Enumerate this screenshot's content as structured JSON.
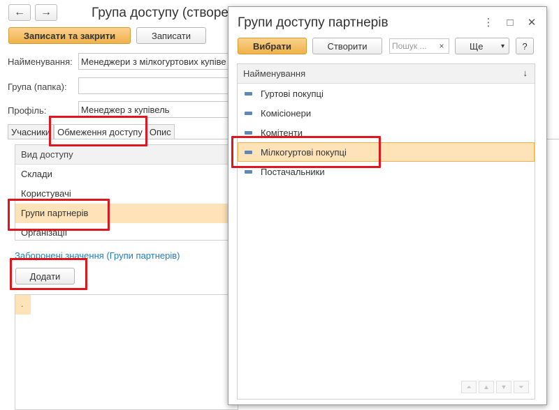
{
  "form": {
    "title": "Група доступу (створе",
    "back_glyph": "←",
    "forward_glyph": "→",
    "save_close_label": "Записати та закрити",
    "save_label": "Записати",
    "fields": {
      "name_label": "Найменування:",
      "name_value": "Менеджери з мілкогуртових купіве",
      "group_label": "Група (папка):",
      "group_value": "",
      "profile_label": "Профіль:",
      "profile_value": "Менеджер з купівель"
    },
    "tabs": [
      "Учасники",
      "Обмеження доступу",
      "Опис"
    ],
    "access_table": {
      "header": "Вид доступу",
      "rows": [
        "Склади",
        "Користувачі",
        "Групи партнерів",
        "Організації"
      ],
      "selected_index": 2
    },
    "forbidden_link": "Заборонені значення (Групи партнерів)",
    "add_button": "Додати",
    "values_marker": "."
  },
  "dialog": {
    "title": "Групи доступу партнерів",
    "more_glyph": "⋮",
    "maximize_glyph": "□",
    "close_glyph": "✕",
    "select_button": "Вибрати",
    "create_button": "Створити",
    "search_placeholder": "Пошук ...",
    "search_clear": "×",
    "more_button": "Ще",
    "more_arrow": "▾",
    "help_button": "?",
    "list": {
      "header": "Найменування",
      "sort_glyph": "↓",
      "items": [
        "Гуртові покупці",
        "Комісіонери",
        "Комітенти",
        "Мілкогуртові покупці",
        "Постачальники"
      ],
      "selected_index": 3
    },
    "scroll_glyphs": [
      "⏶",
      "▲",
      "▼",
      "⏷"
    ]
  },
  "colors": {
    "accent": "#f0b24a",
    "selection": "#fde3b7",
    "highlight": "#e0161d",
    "link": "#1f7fbf"
  },
  "icons": {
    "back": "arrow-left-icon",
    "forward": "arrow-right-icon",
    "item": "catalog-item-icon",
    "sort": "sort-down-icon",
    "close": "close-icon"
  }
}
